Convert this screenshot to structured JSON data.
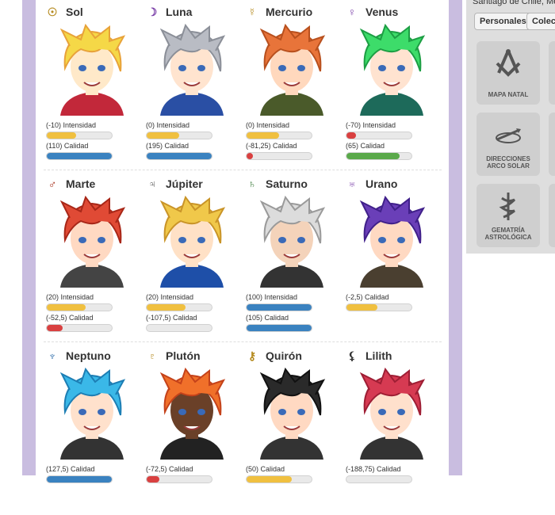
{
  "colors": {
    "yellow": "#f0c040",
    "blue": "#3a82c0",
    "red": "#d94040",
    "green": "#5aa94a",
    "lavender": "#c9bde0"
  },
  "sidebar": {
    "location": "Santiago de Chile, Me",
    "tabs": [
      "Personales",
      "Colect"
    ],
    "tiles": [
      {
        "label_1": "MAPA NATAL",
        "label_2": "",
        "icon": "masonic-compass-icon"
      },
      {
        "label_1": "DIRECCIONES",
        "label_2": "ARCO SOLAR",
        "icon": "arrow-arc-icon"
      },
      {
        "label_1": "GEMATRÍA",
        "label_2": "ASTROLÓGICA",
        "icon": "caduceus-icon"
      }
    ]
  },
  "planets": [
    {
      "name": "Sol",
      "symbol": "☉",
      "icon": "sun-icon",
      "stats": [
        {
          "label": "(-10) Intensidad",
          "fill": 0.45,
          "color": "yellow"
        },
        {
          "label": "(110) Calidad",
          "fill": 1.0,
          "color": "blue"
        }
      ]
    },
    {
      "name": "Luna",
      "symbol": "☽",
      "icon": "moon-icon",
      "stats": [
        {
          "label": "(0) Intensidad",
          "fill": 0.5,
          "color": "yellow"
        },
        {
          "label": "(195) Calidad",
          "fill": 1.0,
          "color": "blue"
        }
      ]
    },
    {
      "name": "Mercurio",
      "symbol": "☿",
      "icon": "mercury-icon",
      "stats": [
        {
          "label": "(0) Intensidad",
          "fill": 0.5,
          "color": "yellow"
        },
        {
          "label": "(-81,25) Calidad",
          "fill": 0.1,
          "color": "red"
        }
      ]
    },
    {
      "name": "Venus",
      "symbol": "♀",
      "icon": "venus-icon",
      "stats": [
        {
          "label": "(-70) Intensidad",
          "fill": 0.15,
          "color": "red"
        },
        {
          "label": "(65) Calidad",
          "fill": 0.82,
          "color": "green"
        }
      ]
    },
    {
      "name": "Marte",
      "symbol": "♂",
      "icon": "mars-icon",
      "stats": [
        {
          "label": "(20) Intensidad",
          "fill": 0.6,
          "color": "yellow"
        },
        {
          "label": "(-52,5) Calidad",
          "fill": 0.24,
          "color": "red"
        }
      ]
    },
    {
      "name": "Júpiter",
      "symbol": "♃",
      "icon": "jupiter-icon",
      "stats": [
        {
          "label": "(20) Intensidad",
          "fill": 0.6,
          "color": "yellow"
        },
        {
          "label": "(-107,5) Calidad",
          "fill": 0.0,
          "color": "red"
        }
      ]
    },
    {
      "name": "Saturno",
      "symbol": "♄",
      "icon": "saturn-icon",
      "stats": [
        {
          "label": "(100) Intensidad",
          "fill": 1.0,
          "color": "blue"
        },
        {
          "label": "(105) Calidad",
          "fill": 1.0,
          "color": "blue"
        }
      ]
    },
    {
      "name": "Urano",
      "symbol": "♅",
      "icon": "uranus-icon",
      "stats": [
        {
          "label": "(-2,5) Calidad",
          "fill": 0.48,
          "color": "yellow"
        }
      ]
    },
    {
      "name": "Neptuno",
      "symbol": "♆",
      "icon": "neptune-icon",
      "stats": [
        {
          "label": "(127,5) Calidad",
          "fill": 1.0,
          "color": "blue"
        }
      ]
    },
    {
      "name": "Plutón",
      "symbol": "♇",
      "icon": "pluto-icon",
      "stats": [
        {
          "label": "(-72,5) Calidad",
          "fill": 0.2,
          "color": "red"
        }
      ]
    },
    {
      "name": "Quirón",
      "symbol": "⚷",
      "icon": "chiron-icon",
      "stats": [
        {
          "label": "(50) Calidad",
          "fill": 0.7,
          "color": "yellow"
        }
      ]
    },
    {
      "name": "Lilith",
      "symbol": "⚸",
      "icon": "lilith-icon",
      "stats": [
        {
          "label": "(-188,75) Calidad",
          "fill": 0.0,
          "color": "red"
        }
      ]
    }
  ]
}
